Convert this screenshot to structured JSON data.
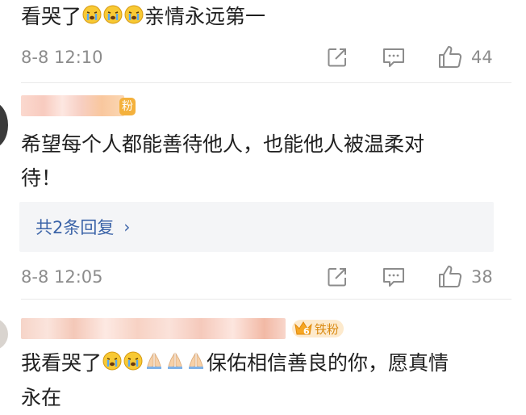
{
  "comments": [
    {
      "text_before_emoji": "看哭了",
      "emoji_after_text": [
        "crying-face",
        "crying-face",
        "crying-face"
      ],
      "text_after_emoji": "亲情永远第一",
      "timestamp": "8-8 12:10",
      "like_count": "44"
    },
    {
      "user_badge_text": "粉",
      "text": "希望每个人都能善待他人，也能他人被温柔对待！",
      "text_line1": "希望每个人都能善待他人，也能他人被温柔对",
      "text_line2": "待！",
      "replies_label": "共2条回复",
      "replies_arrow": "›",
      "timestamp": "8-8 12:05",
      "like_count": "38"
    },
    {
      "user_badge_level": "6",
      "user_badge_text": "铁粉",
      "text_part1": "我看哭了",
      "emoji_group1": [
        "crying-face",
        "crying-face"
      ],
      "emoji_group2": [
        "folded-hands",
        "folded-hands",
        "folded-hands"
      ],
      "text_part2": "保佑相信善良的你，愿真情",
      "text_line2": "永在"
    }
  ],
  "icons": {
    "share": "share-icon",
    "comment": "comment-icon",
    "like": "thumbs-up-icon"
  },
  "colors": {
    "text": "#1f1f1f",
    "meta": "#8c8c8c",
    "link": "#3c64a8",
    "reply_bg": "#f4f5f7",
    "badge_bg": "#fdeacd",
    "badge_text": "#d98a12"
  }
}
